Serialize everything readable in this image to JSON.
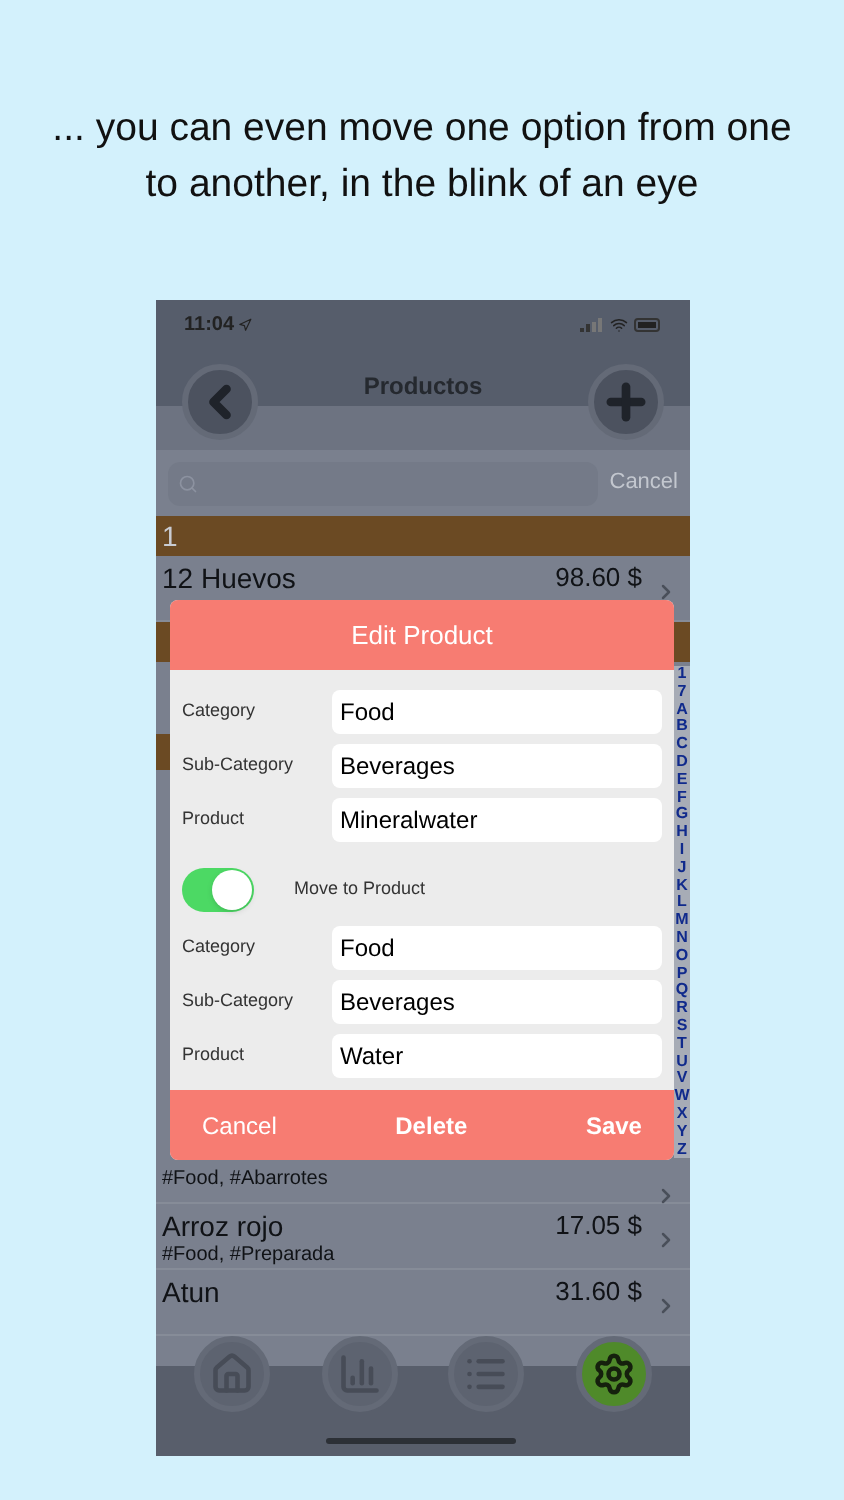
{
  "headline": "... you can even move one option from one to another, in the blink of an eye",
  "status_bar": {
    "time": "11:04"
  },
  "nav": {
    "title": "Productos"
  },
  "search": {
    "cancel": "Cancel"
  },
  "list_top": [
    {
      "kind": "header",
      "label": "1"
    },
    {
      "kind": "product",
      "name": "12 Huevos",
      "price": "98.60 $"
    }
  ],
  "list_bottom": [
    {
      "kind": "product",
      "tags": "#Food, #Abarrotes"
    },
    {
      "kind": "product",
      "name": "Arroz rojo",
      "tags": "#Food, #Preparada",
      "price": "17.05 $"
    },
    {
      "kind": "product",
      "name": "Atun",
      "price": "31.60 $"
    }
  ],
  "index": [
    "1",
    "7",
    "A",
    "B",
    "C",
    "D",
    "E",
    "F",
    "G",
    "H",
    "I",
    "J",
    "K",
    "L",
    "M",
    "N",
    "O",
    "P",
    "Q",
    "R",
    "S",
    "T",
    "U",
    "V",
    "W",
    "X",
    "Y",
    "Z"
  ],
  "tabs": [
    {
      "selected": false
    },
    {
      "selected": false
    },
    {
      "selected": false
    },
    {
      "selected": true
    }
  ],
  "dialog": {
    "title": "Edit Product",
    "fields": [
      {
        "label": "Category",
        "value": "Food"
      },
      {
        "label": "Sub-Category",
        "value": "Beverages"
      },
      {
        "label": "Product",
        "value": "Mineralwater"
      }
    ],
    "toggle": {
      "label": "Move to Product",
      "on": true
    },
    "target_fields": [
      {
        "label": "Category",
        "value": "Food"
      },
      {
        "label": "Sub-Category",
        "value": "Beverages"
      },
      {
        "label": "Product",
        "value": "Water"
      }
    ],
    "buttons": [
      {
        "label": "Cancel",
        "kind": "cancel"
      },
      {
        "label": "Delete",
        "kind": "destructive"
      },
      {
        "label": "Save",
        "kind": "confirm"
      }
    ]
  }
}
